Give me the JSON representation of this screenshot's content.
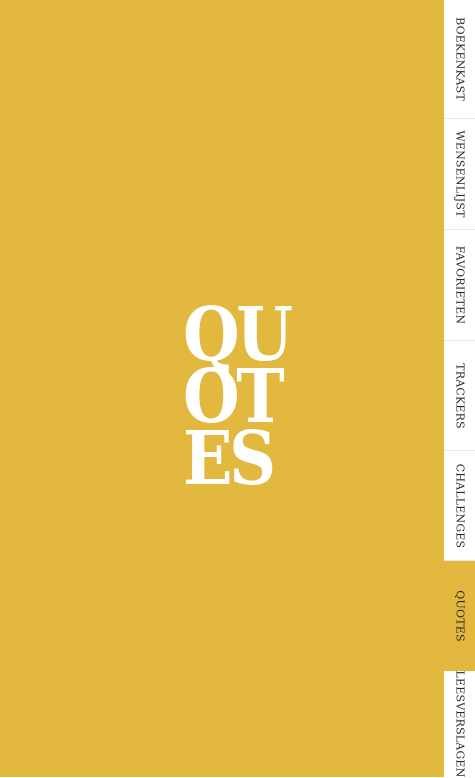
{
  "hero": {
    "lines": [
      "QU",
      "OT",
      "ES"
    ]
  },
  "tabs": [
    {
      "label": "BOEKENKAST",
      "active": false
    },
    {
      "label": "WENSENLIJST",
      "active": false
    },
    {
      "label": "FAVORIETEN",
      "active": false
    },
    {
      "label": "TRACKERS",
      "active": false
    },
    {
      "label": "CHALLENGES",
      "active": false
    },
    {
      "label": "QUOTES",
      "active": true
    },
    {
      "label": "LEESVERSLAGEN",
      "active": false
    }
  ],
  "colors": {
    "accent": "#e3b83e",
    "tab_background": "#ffffff",
    "hero_text": "#ffffff"
  }
}
